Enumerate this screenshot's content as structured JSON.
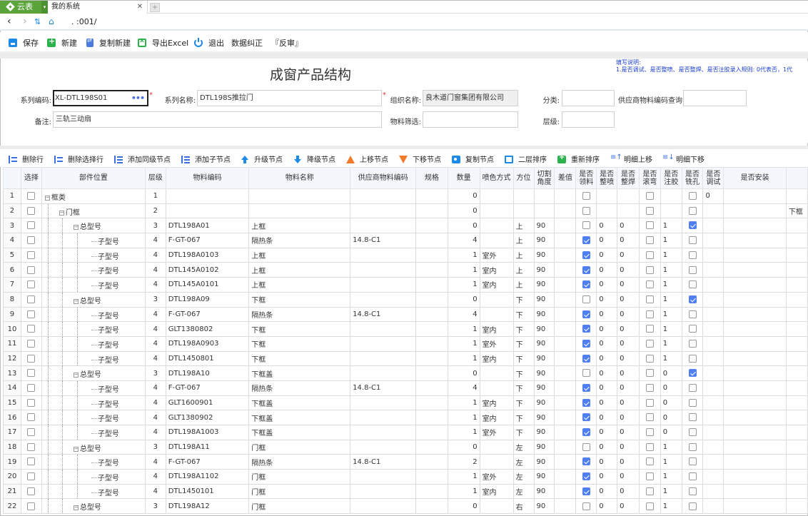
{
  "browser": {
    "brand_label": "云表",
    "tab_title": "我的系统",
    "url": ".            :001/"
  },
  "toolbar": {
    "buttons": [
      {
        "label": "保存",
        "icon": "save-icon"
      },
      {
        "label": "新建",
        "icon": "new-icon"
      },
      {
        "label": "复制新建",
        "icon": "copy-new-icon"
      },
      {
        "label": "导出Excel",
        "icon": "excel-icon"
      },
      {
        "label": "退出",
        "icon": "power-icon"
      },
      {
        "label": "数据纠正",
        "icon": ""
      },
      {
        "label": "『反审』",
        "icon": ""
      }
    ]
  },
  "form": {
    "title": "成窗产品结构",
    "notes_title": "填写说明:",
    "notes_line1": "1.是否调试、是否整喷、是否整焊、是否注胶录入规则: 0代表否，1代",
    "fields": {
      "series_code": {
        "label": "系列编码:",
        "value": "XL-DTL198S01"
      },
      "series_name": {
        "label": "系列名称:",
        "value": "DTL198S推拉门"
      },
      "org_name": {
        "label": "组织名称:",
        "value": "良木道门窗集团有限公司"
      },
      "category": {
        "label": "分类:",
        "value": ""
      },
      "supplier_query": {
        "label": "供应商物料编码查询:",
        "value": ""
      },
      "remark": {
        "label": "备注:",
        "value": "三轨三动扇"
      },
      "material_filter": {
        "label": "物料筛选:",
        "value": ""
      },
      "level": {
        "label": "层级:",
        "value": ""
      }
    }
  },
  "grid_toolbar": {
    "buttons": [
      {
        "label": "删除行",
        "icon": "delete-row-icon"
      },
      {
        "label": "删除选择行",
        "icon": "delete-selected-icon"
      },
      {
        "label": "添加同级节点",
        "icon": "add-sibling-icon"
      },
      {
        "label": "添加子节点",
        "icon": "add-child-icon"
      },
      {
        "label": "升级节点",
        "icon": "promote-icon"
      },
      {
        "label": "降级节点",
        "icon": "demote-icon"
      },
      {
        "label": "上移节点",
        "icon": "move-up-icon"
      },
      {
        "label": "下移节点",
        "icon": "move-down-icon"
      },
      {
        "label": "复制节点",
        "icon": "copy-node-icon"
      },
      {
        "label": "二层排序",
        "icon": "sort-icon"
      },
      {
        "label": "重新排序",
        "icon": "resort-icon"
      },
      {
        "label": "明细上移",
        "icon": "detail-up-icon"
      },
      {
        "label": "明细下移",
        "icon": "detail-down-icon"
      }
    ]
  },
  "grid": {
    "columns": [
      "",
      "选择",
      "部件位置",
      "层级",
      "物料编码",
      "物料名称",
      "供应商物料编码",
      "规格",
      "数量",
      "喷色方式",
      "方位",
      "切割角度",
      "差值",
      "是否领料",
      "是否整喷",
      "是否整焊",
      "是否滚弯",
      "是否注胶",
      "是否铣孔",
      "是否调试",
      "是否安装",
      ""
    ],
    "rows": [
      {
        "n": "1",
        "part": "框类",
        "depth": 0,
        "expand": true,
        "level": "1",
        "code": "",
        "name": "",
        "supplier": "",
        "spec": "",
        "qty": "0",
        "spray": "",
        "pos": "",
        "angle": "",
        "diff": "",
        "pick": false,
        "zp": "",
        "zh": "",
        "gw": false,
        "zj": "",
        "xk": false,
        "ts": "0",
        "az": "",
        "extra": ""
      },
      {
        "n": "2",
        "part": "门框",
        "depth": 1,
        "expand": true,
        "level": "2",
        "code": "",
        "name": "",
        "supplier": "",
        "spec": "",
        "qty": "0",
        "spray": "",
        "pos": "",
        "angle": "",
        "diff": "",
        "pick": false,
        "zp": "",
        "zh": "",
        "gw": false,
        "zj": "",
        "xk": false,
        "ts": "",
        "az": "",
        "extra": "下框"
      },
      {
        "n": "3",
        "part": "总型号",
        "depth": 2,
        "expand": true,
        "level": "3",
        "code": "DTL198A01",
        "name": "上框",
        "supplier": "",
        "spec": "",
        "qty": "0",
        "spray": "",
        "pos": "上",
        "angle": "90",
        "diff": "",
        "pick": false,
        "zp": "0",
        "zh": "0",
        "gw": false,
        "zj": "1",
        "xk": true,
        "ts": "",
        "az": "",
        "extra": ""
      },
      {
        "n": "4",
        "part": "子型号",
        "depth": 3,
        "expand": false,
        "level": "4",
        "code": "F-GT-067",
        "name": "隔热条",
        "supplier": "14.8-C1",
        "spec": "",
        "qty": "4",
        "spray": "",
        "pos": "上",
        "angle": "90",
        "diff": "",
        "pick": true,
        "zp": "0",
        "zh": "0",
        "gw": false,
        "zj": "1",
        "xk": false,
        "ts": "",
        "az": "",
        "extra": ""
      },
      {
        "n": "5",
        "part": "子型号",
        "depth": 3,
        "expand": false,
        "level": "4",
        "code": "DTL198A0103",
        "name": "上框",
        "supplier": "",
        "spec": "",
        "qty": "1",
        "spray": "室外",
        "pos": "上",
        "angle": "90",
        "diff": "",
        "pick": true,
        "zp": "0",
        "zh": "0",
        "gw": false,
        "zj": "1",
        "xk": false,
        "ts": "",
        "az": "",
        "extra": ""
      },
      {
        "n": "6",
        "part": "子型号",
        "depth": 3,
        "expand": false,
        "level": "4",
        "code": "DTL145A0102",
        "name": "上框",
        "supplier": "",
        "spec": "",
        "qty": "1",
        "spray": "室内",
        "pos": "上",
        "angle": "90",
        "diff": "",
        "pick": true,
        "zp": "0",
        "zh": "0",
        "gw": false,
        "zj": "1",
        "xk": false,
        "ts": "",
        "az": "",
        "extra": ""
      },
      {
        "n": "7",
        "part": "子型号",
        "depth": 3,
        "expand": false,
        "level": "4",
        "code": "DTL145A0101",
        "name": "上框",
        "supplier": "",
        "spec": "",
        "qty": "1",
        "spray": "室内",
        "pos": "上",
        "angle": "90",
        "diff": "",
        "pick": true,
        "zp": "0",
        "zh": "0",
        "gw": false,
        "zj": "1",
        "xk": false,
        "ts": "",
        "az": "",
        "extra": ""
      },
      {
        "n": "8",
        "part": "总型号",
        "depth": 2,
        "expand": true,
        "level": "3",
        "code": "DTL198A09",
        "name": "下框",
        "supplier": "",
        "spec": "",
        "qty": "0",
        "spray": "",
        "pos": "下",
        "angle": "90",
        "diff": "",
        "pick": false,
        "zp": "0",
        "zh": "0",
        "gw": false,
        "zj": "1",
        "xk": true,
        "ts": "",
        "az": "",
        "extra": ""
      },
      {
        "n": "9",
        "part": "子型号",
        "depth": 3,
        "expand": false,
        "level": "4",
        "code": "F-GT-067",
        "name": "隔热条",
        "supplier": "14.8-C1",
        "spec": "",
        "qty": "4",
        "spray": "",
        "pos": "下",
        "angle": "90",
        "diff": "",
        "pick": true,
        "zp": "0",
        "zh": "0",
        "gw": false,
        "zj": "1",
        "xk": false,
        "ts": "",
        "az": "",
        "extra": ""
      },
      {
        "n": "10",
        "part": "子型号",
        "depth": 3,
        "expand": false,
        "level": "4",
        "code": "GLT1380802",
        "name": "下框",
        "supplier": "",
        "spec": "",
        "qty": "1",
        "spray": "室内",
        "pos": "下",
        "angle": "90",
        "diff": "",
        "pick": true,
        "zp": "0",
        "zh": "0",
        "gw": false,
        "zj": "1",
        "xk": false,
        "ts": "",
        "az": "",
        "extra": ""
      },
      {
        "n": "11",
        "part": "子型号",
        "depth": 3,
        "expand": false,
        "level": "4",
        "code": "DTL198A0903",
        "name": "下框",
        "supplier": "",
        "spec": "",
        "qty": "1",
        "spray": "室外",
        "pos": "下",
        "angle": "90",
        "diff": "",
        "pick": true,
        "zp": "0",
        "zh": "0",
        "gw": false,
        "zj": "1",
        "xk": false,
        "ts": "",
        "az": "",
        "extra": ""
      },
      {
        "n": "12",
        "part": "子型号",
        "depth": 3,
        "expand": false,
        "level": "4",
        "code": "DTL1450801",
        "name": "下框",
        "supplier": "",
        "spec": "",
        "qty": "1",
        "spray": "室内",
        "pos": "下",
        "angle": "90",
        "diff": "",
        "pick": true,
        "zp": "0",
        "zh": "0",
        "gw": false,
        "zj": "1",
        "xk": false,
        "ts": "",
        "az": "",
        "extra": ""
      },
      {
        "n": "13",
        "part": "总型号",
        "depth": 2,
        "expand": true,
        "level": "3",
        "code": "DTL198A10",
        "name": "下框盖",
        "supplier": "",
        "spec": "",
        "qty": "0",
        "spray": "",
        "pos": "下",
        "angle": "90",
        "diff": "",
        "pick": false,
        "zp": "0",
        "zh": "0",
        "gw": false,
        "zj": "0",
        "xk": true,
        "ts": "",
        "az": "",
        "extra": ""
      },
      {
        "n": "14",
        "part": "子型号",
        "depth": 3,
        "expand": false,
        "level": "4",
        "code": "F-GT-067",
        "name": "隔热条",
        "supplier": "14.8-C1",
        "spec": "",
        "qty": "4",
        "spray": "",
        "pos": "下",
        "angle": "90",
        "diff": "",
        "pick": true,
        "zp": "0",
        "zh": "0",
        "gw": false,
        "zj": "0",
        "xk": false,
        "ts": "",
        "az": "",
        "extra": ""
      },
      {
        "n": "15",
        "part": "子型号",
        "depth": 3,
        "expand": false,
        "level": "4",
        "code": "GLT1600901",
        "name": "下框盖",
        "supplier": "",
        "spec": "",
        "qty": "1",
        "spray": "室内",
        "pos": "下",
        "angle": "90",
        "diff": "",
        "pick": true,
        "zp": "0",
        "zh": "0",
        "gw": false,
        "zj": "0",
        "xk": false,
        "ts": "",
        "az": "",
        "extra": ""
      },
      {
        "n": "16",
        "part": "子型号",
        "depth": 3,
        "expand": false,
        "level": "4",
        "code": "GLT1380902",
        "name": "下框盖",
        "supplier": "",
        "spec": "",
        "qty": "1",
        "spray": "室内",
        "pos": "下",
        "angle": "90",
        "diff": "",
        "pick": true,
        "zp": "0",
        "zh": "0",
        "gw": false,
        "zj": "0",
        "xk": false,
        "ts": "",
        "az": "",
        "extra": ""
      },
      {
        "n": "17",
        "part": "子型号",
        "depth": 3,
        "expand": false,
        "level": "4",
        "code": "DTL198A1003",
        "name": "下框盖",
        "supplier": "",
        "spec": "",
        "qty": "1",
        "spray": "室外",
        "pos": "下",
        "angle": "90",
        "diff": "",
        "pick": true,
        "zp": "0",
        "zh": "0",
        "gw": false,
        "zj": "0",
        "xk": false,
        "ts": "",
        "az": "",
        "extra": ""
      },
      {
        "n": "18",
        "part": "总型号",
        "depth": 2,
        "expand": true,
        "level": "3",
        "code": "DTL198A11",
        "name": "门框",
        "supplier": "",
        "spec": "",
        "qty": "0",
        "spray": "",
        "pos": "左",
        "angle": "90",
        "diff": "",
        "pick": false,
        "zp": "0",
        "zh": "0",
        "gw": false,
        "zj": "1",
        "xk": false,
        "ts": "",
        "az": "",
        "extra": ""
      },
      {
        "n": "19",
        "part": "子型号",
        "depth": 3,
        "expand": false,
        "level": "4",
        "code": "F-GT-067",
        "name": "隔热条",
        "supplier": "14.8-C1",
        "spec": "",
        "qty": "2",
        "spray": "",
        "pos": "左",
        "angle": "90",
        "diff": "",
        "pick": true,
        "zp": "0",
        "zh": "0",
        "gw": false,
        "zj": "1",
        "xk": false,
        "ts": "",
        "az": "",
        "extra": ""
      },
      {
        "n": "20",
        "part": "子型号",
        "depth": 3,
        "expand": false,
        "level": "4",
        "code": "DTL198A1102",
        "name": "门框",
        "supplier": "",
        "spec": "",
        "qty": "1",
        "spray": "室外",
        "pos": "左",
        "angle": "90",
        "diff": "",
        "pick": true,
        "zp": "0",
        "zh": "0",
        "gw": false,
        "zj": "1",
        "xk": false,
        "ts": "",
        "az": "",
        "extra": ""
      },
      {
        "n": "21",
        "part": "子型号",
        "depth": 3,
        "expand": false,
        "level": "4",
        "code": "DTL1450101",
        "name": "门框",
        "supplier": "",
        "spec": "",
        "qty": "1",
        "spray": "室内",
        "pos": "左",
        "angle": "90",
        "diff": "",
        "pick": true,
        "zp": "0",
        "zh": "0",
        "gw": false,
        "zj": "1",
        "xk": false,
        "ts": "",
        "az": "",
        "extra": ""
      },
      {
        "n": "22",
        "part": "总型号",
        "depth": 2,
        "expand": true,
        "level": "3",
        "code": "DTL198A12",
        "name": "门框",
        "supplier": "",
        "spec": "",
        "qty": "0",
        "spray": "",
        "pos": "右",
        "angle": "90",
        "diff": "",
        "pick": false,
        "zp": "0",
        "zh": "0",
        "gw": false,
        "zj": "1",
        "xk": false,
        "ts": "",
        "az": "",
        "extra": ""
      }
    ]
  }
}
